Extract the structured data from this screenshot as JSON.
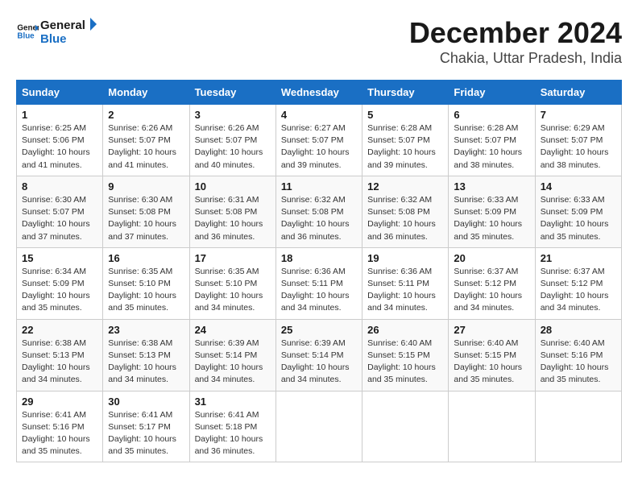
{
  "header": {
    "logo_line1": "General",
    "logo_line2": "Blue",
    "main_title": "December 2024",
    "subtitle": "Chakia, Uttar Pradesh, India"
  },
  "calendar": {
    "headers": [
      "Sunday",
      "Monday",
      "Tuesday",
      "Wednesday",
      "Thursday",
      "Friday",
      "Saturday"
    ],
    "weeks": [
      [
        {
          "day": "",
          "info": ""
        },
        {
          "day": "2",
          "info": "Sunrise: 6:26 AM\nSunset: 5:07 PM\nDaylight: 10 hours and 41 minutes."
        },
        {
          "day": "3",
          "info": "Sunrise: 6:26 AM\nSunset: 5:07 PM\nDaylight: 10 hours and 40 minutes."
        },
        {
          "day": "4",
          "info": "Sunrise: 6:27 AM\nSunset: 5:07 PM\nDaylight: 10 hours and 39 minutes."
        },
        {
          "day": "5",
          "info": "Sunrise: 6:28 AM\nSunset: 5:07 PM\nDaylight: 10 hours and 39 minutes."
        },
        {
          "day": "6",
          "info": "Sunrise: 6:28 AM\nSunset: 5:07 PM\nDaylight: 10 hours and 38 minutes."
        },
        {
          "day": "7",
          "info": "Sunrise: 6:29 AM\nSunset: 5:07 PM\nDaylight: 10 hours and 38 minutes."
        }
      ],
      [
        {
          "day": "1",
          "info": "Sunrise: 6:25 AM\nSunset: 5:06 PM\nDaylight: 10 hours and 41 minutes."
        },
        {
          "day": "9",
          "info": "Sunrise: 6:30 AM\nSunset: 5:08 PM\nDaylight: 10 hours and 37 minutes."
        },
        {
          "day": "10",
          "info": "Sunrise: 6:31 AM\nSunset: 5:08 PM\nDaylight: 10 hours and 36 minutes."
        },
        {
          "day": "11",
          "info": "Sunrise: 6:32 AM\nSunset: 5:08 PM\nDaylight: 10 hours and 36 minutes."
        },
        {
          "day": "12",
          "info": "Sunrise: 6:32 AM\nSunset: 5:08 PM\nDaylight: 10 hours and 36 minutes."
        },
        {
          "day": "13",
          "info": "Sunrise: 6:33 AM\nSunset: 5:09 PM\nDaylight: 10 hours and 35 minutes."
        },
        {
          "day": "14",
          "info": "Sunrise: 6:33 AM\nSunset: 5:09 PM\nDaylight: 10 hours and 35 minutes."
        }
      ],
      [
        {
          "day": "8",
          "info": "Sunrise: 6:30 AM\nSunset: 5:07 PM\nDaylight: 10 hours and 37 minutes."
        },
        {
          "day": "16",
          "info": "Sunrise: 6:35 AM\nSunset: 5:10 PM\nDaylight: 10 hours and 35 minutes."
        },
        {
          "day": "17",
          "info": "Sunrise: 6:35 AM\nSunset: 5:10 PM\nDaylight: 10 hours and 34 minutes."
        },
        {
          "day": "18",
          "info": "Sunrise: 6:36 AM\nSunset: 5:11 PM\nDaylight: 10 hours and 34 minutes."
        },
        {
          "day": "19",
          "info": "Sunrise: 6:36 AM\nSunset: 5:11 PM\nDaylight: 10 hours and 34 minutes."
        },
        {
          "day": "20",
          "info": "Sunrise: 6:37 AM\nSunset: 5:12 PM\nDaylight: 10 hours and 34 minutes."
        },
        {
          "day": "21",
          "info": "Sunrise: 6:37 AM\nSunset: 5:12 PM\nDaylight: 10 hours and 34 minutes."
        }
      ],
      [
        {
          "day": "15",
          "info": "Sunrise: 6:34 AM\nSunset: 5:09 PM\nDaylight: 10 hours and 35 minutes."
        },
        {
          "day": "23",
          "info": "Sunrise: 6:38 AM\nSunset: 5:13 PM\nDaylight: 10 hours and 34 minutes."
        },
        {
          "day": "24",
          "info": "Sunrise: 6:39 AM\nSunset: 5:14 PM\nDaylight: 10 hours and 34 minutes."
        },
        {
          "day": "25",
          "info": "Sunrise: 6:39 AM\nSunset: 5:14 PM\nDaylight: 10 hours and 34 minutes."
        },
        {
          "day": "26",
          "info": "Sunrise: 6:40 AM\nSunset: 5:15 PM\nDaylight: 10 hours and 35 minutes."
        },
        {
          "day": "27",
          "info": "Sunrise: 6:40 AM\nSunset: 5:15 PM\nDaylight: 10 hours and 35 minutes."
        },
        {
          "day": "28",
          "info": "Sunrise: 6:40 AM\nSunset: 5:16 PM\nDaylight: 10 hours and 35 minutes."
        }
      ],
      [
        {
          "day": "22",
          "info": "Sunrise: 6:38 AM\nSunset: 5:13 PM\nDaylight: 10 hours and 34 minutes."
        },
        {
          "day": "30",
          "info": "Sunrise: 6:41 AM\nSunset: 5:17 PM\nDaylight: 10 hours and 35 minutes."
        },
        {
          "day": "31",
          "info": "Sunrise: 6:41 AM\nSunset: 5:18 PM\nDaylight: 10 hours and 36 minutes."
        },
        {
          "day": "",
          "info": ""
        },
        {
          "day": "",
          "info": ""
        },
        {
          "day": "",
          "info": ""
        },
        {
          "day": ""
        }
      ],
      [
        {
          "day": "29",
          "info": "Sunrise: 6:41 AM\nSunset: 5:16 PM\nDaylight: 10 hours and 35 minutes."
        },
        {
          "day": "",
          "info": ""
        },
        {
          "day": "",
          "info": ""
        },
        {
          "day": "",
          "info": ""
        },
        {
          "day": "",
          "info": ""
        },
        {
          "day": "",
          "info": ""
        },
        {
          "day": "",
          "info": ""
        }
      ]
    ]
  }
}
